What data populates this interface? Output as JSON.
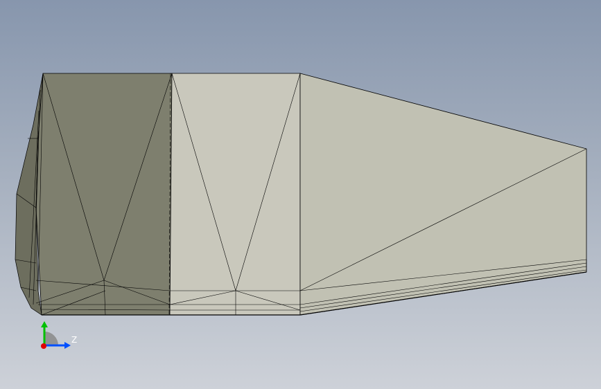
{
  "viewport": {
    "background_top": "#8796ad",
    "background_bottom": "#cdd1d8"
  },
  "model": {
    "face_dark": "#7e7f6e",
    "face_mid": "#c8c7bb",
    "face_light": "#c0c0b2",
    "edge_color": "#000000"
  },
  "triad": {
    "z_label": "Z",
    "x_color": "#e00000",
    "y_color": "#00c000",
    "z_color": "#0050ff"
  }
}
